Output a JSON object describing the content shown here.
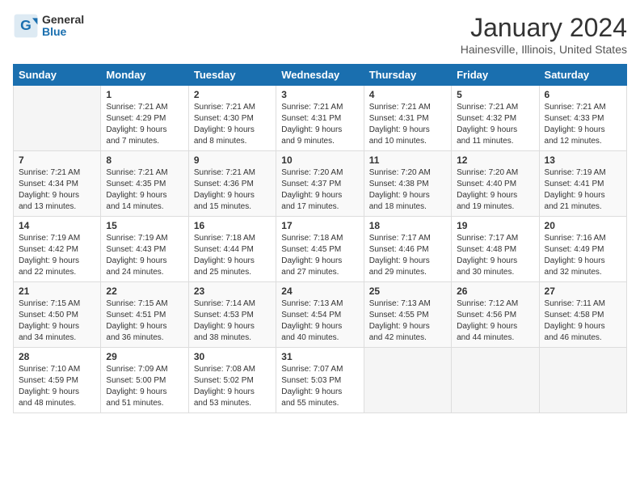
{
  "header": {
    "logo_general": "General",
    "logo_blue": "Blue",
    "month_year": "January 2024",
    "location": "Hainesville, Illinois, United States"
  },
  "days_of_week": [
    "Sunday",
    "Monday",
    "Tuesday",
    "Wednesday",
    "Thursday",
    "Friday",
    "Saturday"
  ],
  "weeks": [
    [
      {
        "day": "",
        "info": ""
      },
      {
        "day": "1",
        "info": "Sunrise: 7:21 AM\nSunset: 4:29 PM\nDaylight: 9 hours\nand 7 minutes."
      },
      {
        "day": "2",
        "info": "Sunrise: 7:21 AM\nSunset: 4:30 PM\nDaylight: 9 hours\nand 8 minutes."
      },
      {
        "day": "3",
        "info": "Sunrise: 7:21 AM\nSunset: 4:31 PM\nDaylight: 9 hours\nand 9 minutes."
      },
      {
        "day": "4",
        "info": "Sunrise: 7:21 AM\nSunset: 4:31 PM\nDaylight: 9 hours\nand 10 minutes."
      },
      {
        "day": "5",
        "info": "Sunrise: 7:21 AM\nSunset: 4:32 PM\nDaylight: 9 hours\nand 11 minutes."
      },
      {
        "day": "6",
        "info": "Sunrise: 7:21 AM\nSunset: 4:33 PM\nDaylight: 9 hours\nand 12 minutes."
      }
    ],
    [
      {
        "day": "7",
        "info": "Sunrise: 7:21 AM\nSunset: 4:34 PM\nDaylight: 9 hours\nand 13 minutes."
      },
      {
        "day": "8",
        "info": "Sunrise: 7:21 AM\nSunset: 4:35 PM\nDaylight: 9 hours\nand 14 minutes."
      },
      {
        "day": "9",
        "info": "Sunrise: 7:21 AM\nSunset: 4:36 PM\nDaylight: 9 hours\nand 15 minutes."
      },
      {
        "day": "10",
        "info": "Sunrise: 7:20 AM\nSunset: 4:37 PM\nDaylight: 9 hours\nand 17 minutes."
      },
      {
        "day": "11",
        "info": "Sunrise: 7:20 AM\nSunset: 4:38 PM\nDaylight: 9 hours\nand 18 minutes."
      },
      {
        "day": "12",
        "info": "Sunrise: 7:20 AM\nSunset: 4:40 PM\nDaylight: 9 hours\nand 19 minutes."
      },
      {
        "day": "13",
        "info": "Sunrise: 7:19 AM\nSunset: 4:41 PM\nDaylight: 9 hours\nand 21 minutes."
      }
    ],
    [
      {
        "day": "14",
        "info": "Sunrise: 7:19 AM\nSunset: 4:42 PM\nDaylight: 9 hours\nand 22 minutes."
      },
      {
        "day": "15",
        "info": "Sunrise: 7:19 AM\nSunset: 4:43 PM\nDaylight: 9 hours\nand 24 minutes."
      },
      {
        "day": "16",
        "info": "Sunrise: 7:18 AM\nSunset: 4:44 PM\nDaylight: 9 hours\nand 25 minutes."
      },
      {
        "day": "17",
        "info": "Sunrise: 7:18 AM\nSunset: 4:45 PM\nDaylight: 9 hours\nand 27 minutes."
      },
      {
        "day": "18",
        "info": "Sunrise: 7:17 AM\nSunset: 4:46 PM\nDaylight: 9 hours\nand 29 minutes."
      },
      {
        "day": "19",
        "info": "Sunrise: 7:17 AM\nSunset: 4:48 PM\nDaylight: 9 hours\nand 30 minutes."
      },
      {
        "day": "20",
        "info": "Sunrise: 7:16 AM\nSunset: 4:49 PM\nDaylight: 9 hours\nand 32 minutes."
      }
    ],
    [
      {
        "day": "21",
        "info": "Sunrise: 7:15 AM\nSunset: 4:50 PM\nDaylight: 9 hours\nand 34 minutes."
      },
      {
        "day": "22",
        "info": "Sunrise: 7:15 AM\nSunset: 4:51 PM\nDaylight: 9 hours\nand 36 minutes."
      },
      {
        "day": "23",
        "info": "Sunrise: 7:14 AM\nSunset: 4:53 PM\nDaylight: 9 hours\nand 38 minutes."
      },
      {
        "day": "24",
        "info": "Sunrise: 7:13 AM\nSunset: 4:54 PM\nDaylight: 9 hours\nand 40 minutes."
      },
      {
        "day": "25",
        "info": "Sunrise: 7:13 AM\nSunset: 4:55 PM\nDaylight: 9 hours\nand 42 minutes."
      },
      {
        "day": "26",
        "info": "Sunrise: 7:12 AM\nSunset: 4:56 PM\nDaylight: 9 hours\nand 44 minutes."
      },
      {
        "day": "27",
        "info": "Sunrise: 7:11 AM\nSunset: 4:58 PM\nDaylight: 9 hours\nand 46 minutes."
      }
    ],
    [
      {
        "day": "28",
        "info": "Sunrise: 7:10 AM\nSunset: 4:59 PM\nDaylight: 9 hours\nand 48 minutes."
      },
      {
        "day": "29",
        "info": "Sunrise: 7:09 AM\nSunset: 5:00 PM\nDaylight: 9 hours\nand 51 minutes."
      },
      {
        "day": "30",
        "info": "Sunrise: 7:08 AM\nSunset: 5:02 PM\nDaylight: 9 hours\nand 53 minutes."
      },
      {
        "day": "31",
        "info": "Sunrise: 7:07 AM\nSunset: 5:03 PM\nDaylight: 9 hours\nand 55 minutes."
      },
      {
        "day": "",
        "info": ""
      },
      {
        "day": "",
        "info": ""
      },
      {
        "day": "",
        "info": ""
      }
    ]
  ]
}
